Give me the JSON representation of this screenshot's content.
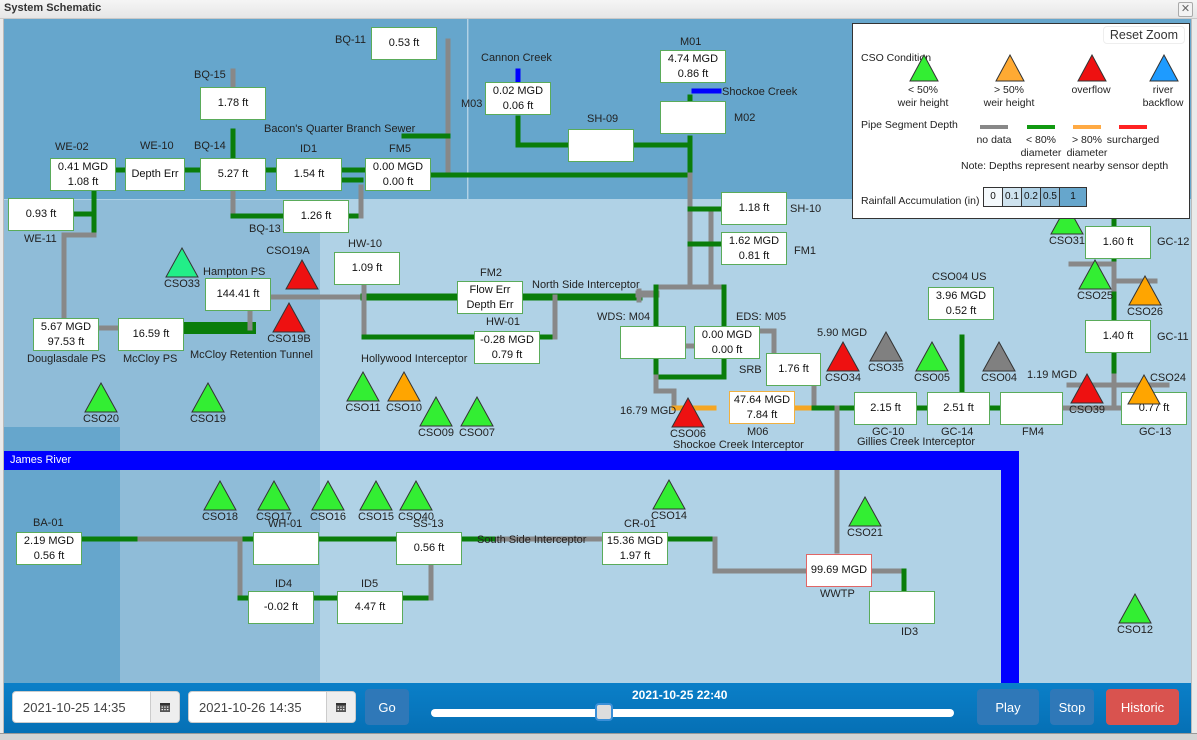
{
  "window": {
    "title": "System Schematic",
    "close_icon": "close-icon"
  },
  "legend": {
    "reset_zoom": "Reset Zoom",
    "cso_condition_title": "CSO Condition",
    "cso_conditions": [
      {
        "label1": "< 50%",
        "label2": "weir height",
        "color": "#33ee33"
      },
      {
        "label1": "> 50%",
        "label2": "weir height",
        "color": "#ffaa33"
      },
      {
        "label1": "overflow",
        "label2": "",
        "color": "#ee1111"
      },
      {
        "label1": "river",
        "label2": "backflow",
        "color": "#1e9bff"
      }
    ],
    "pipe_depth_title": "Pipe Segment Depth",
    "pipe_depths": [
      {
        "label1": "no data",
        "label2": "",
        "color": "#888888"
      },
      {
        "label1": "< 80%",
        "label2": "diameter",
        "color": "#119911"
      },
      {
        "label1": "> 80%",
        "label2": "diameter",
        "color": "#ffaa44"
      },
      {
        "label1": "surcharged",
        "label2": "",
        "color": "#ff2222"
      }
    ],
    "note": "Note: Depths represent nearby sensor depth",
    "rainfall_title": "Rainfall Accumulation (in)",
    "rainfall_scale": [
      {
        "label": "0",
        "color": "#f4f9fc"
      },
      {
        "label": "0.1",
        "color": "#cfe3ef"
      },
      {
        "label": "0.2",
        "color": "#b0d2e6"
      },
      {
        "label": "0.5",
        "color": "#8fbcd8"
      },
      {
        "label": "1",
        "color": "#66a6cc"
      }
    ]
  },
  "colors": {
    "pipe_ok": "#0a7d0a",
    "pipe_nodata": "#888888",
    "pipe_high": "#f5a623",
    "creek": "#0000ff",
    "river": "#0000ff"
  },
  "river": {
    "label": "James River"
  },
  "nodes": {
    "bq11": {
      "name": "BQ-11",
      "line1": "0.53 ft",
      "line2": ""
    },
    "bq15": {
      "name": "BQ-15",
      "line1": "1.78 ft",
      "line2": ""
    },
    "we02": {
      "name": "WE-02",
      "line1": "0.41 MGD",
      "line2": "1.08 ft"
    },
    "we10": {
      "name": "WE-10",
      "line1": "Depth Err",
      "line2": ""
    },
    "bq14": {
      "name": "BQ-14",
      "line1": "5.27 ft",
      "line2": ""
    },
    "id1": {
      "name": "ID1",
      "line1": "1.54 ft",
      "line2": ""
    },
    "fm5": {
      "name": "FM5",
      "line1": "0.00 MGD",
      "line2": "0.00 ft"
    },
    "bq13": {
      "name": "BQ-13",
      "line1": "1.26 ft",
      "line2": ""
    },
    "we11": {
      "name": "WE-11",
      "line1": "0.93 ft",
      "line2": ""
    },
    "m03": {
      "name": "M03",
      "line1": "0.02 MGD",
      "line2": "0.06 ft"
    },
    "sh09": {
      "name": "SH-09",
      "line1": "",
      "line2": ""
    },
    "m01": {
      "name": "M01",
      "line1": "4.74 MGD",
      "line2": "0.86 ft"
    },
    "m02": {
      "name": "M02",
      "line1": "",
      "line2": ""
    },
    "sh10": {
      "name": "SH-10",
      "line1": "1.18 ft",
      "line2": ""
    },
    "fm1": {
      "name": "FM1",
      "line1": "1.62 MGD",
      "line2": "0.81 ft"
    },
    "hw10": {
      "name": "HW-10",
      "line1": "1.09 ft",
      "line2": ""
    },
    "hampton": {
      "name": "Hampton PS",
      "line1": "144.41 ft",
      "line2": ""
    },
    "douglasdale": {
      "name": "Douglasdale PS",
      "line1": "5.67 MGD",
      "line2": "97.53 ft"
    },
    "mccloy": {
      "name": "McCloy PS",
      "line1": "16.59 ft",
      "line2": ""
    },
    "fm2": {
      "name": "FM2",
      "line1": "Flow Err",
      "line2": "Depth Err"
    },
    "hw01": {
      "name": "HW-01",
      "line1": "-0.28 MGD",
      "line2": "0.79 ft"
    },
    "m04": {
      "name": "WDS: M04",
      "line1": "",
      "line2": ""
    },
    "m05": {
      "name": "EDS: M05",
      "line1": "0.00 MGD",
      "line2": "0.00 ft"
    },
    "srb": {
      "name": "SRB",
      "line1": "1.76 ft",
      "line2": ""
    },
    "m06": {
      "name": "M06",
      "line1": "47.64 MGD",
      "line2": "7.84 ft"
    },
    "cso04us": {
      "name": "CSO04 US",
      "line1": "3.96 MGD",
      "line2": "0.52 ft"
    },
    "gc10": {
      "name": "GC-10",
      "line1": "2.15 ft",
      "line2": ""
    },
    "gc14": {
      "name": "GC-14",
      "line1": "2.51 ft",
      "line2": ""
    },
    "fm4": {
      "name": "FM4",
      "line1": "",
      "line2": ""
    },
    "gc12": {
      "name": "GC-12",
      "line1": "1.60 ft",
      "line2": ""
    },
    "gc11": {
      "name": "GC-11",
      "line1": "1.40 ft",
      "line2": ""
    },
    "gc13": {
      "name": "GC-13",
      "line1": "0.77 ft",
      "line2": ""
    },
    "ba01": {
      "name": "BA-01",
      "line1": "2.19 MGD",
      "line2": "0.56 ft"
    },
    "wh01": {
      "name": "WH-01",
      "line1": "",
      "line2": ""
    },
    "ss13": {
      "name": "SS-13",
      "line1": "0.56 ft",
      "line2": ""
    },
    "id4": {
      "name": "ID4",
      "line1": "-0.02 ft",
      "line2": ""
    },
    "id5": {
      "name": "ID5",
      "line1": "4.47 ft",
      "line2": ""
    },
    "cr01": {
      "name": "CR-01",
      "line1": "15.36 MGD",
      "line2": "1.97 ft"
    },
    "wwtp": {
      "name": "WWTP",
      "line1": "99.69 MGD",
      "line2": ""
    },
    "id3": {
      "name": "ID3",
      "line1": "",
      "line2": ""
    }
  },
  "labels": {
    "bacons_quarter": "Bacon's Quarter Branch Sewer",
    "cannon_creek": "Cannon Creek",
    "shockoe_creek": "Shockoe Creek",
    "north_side": "North Side Interceptor",
    "hollywood": "Hollywood Interceptor",
    "mccloy_tunnel": "McCloy Retention Tunnel",
    "shockoe_interceptor": "Shockoe Creek Interceptor",
    "gillies": "Gillies Creek Interceptor",
    "south_side": "South Side Interceptor"
  },
  "csos": [
    {
      "id": "CSO33",
      "status": "lt50",
      "color": "#22ee88",
      "flow": ""
    },
    {
      "id": "CSO19A",
      "status": "overflow",
      "color": "#ee1111",
      "flow": ""
    },
    {
      "id": "CSO19B",
      "status": "overflow",
      "color": "#ee1111",
      "flow": ""
    },
    {
      "id": "CSO20",
      "status": "lt50",
      "color": "#33ee33",
      "flow": ""
    },
    {
      "id": "CSO19",
      "status": "lt50",
      "color": "#33ee33",
      "flow": ""
    },
    {
      "id": "CSO11",
      "status": "lt50",
      "color": "#33ee33",
      "flow": ""
    },
    {
      "id": "CSO10",
      "status": "gt50",
      "color": "#ffa500",
      "flow": ""
    },
    {
      "id": "CSO09",
      "status": "lt50",
      "color": "#33ee33",
      "flow": ""
    },
    {
      "id": "CSO07",
      "status": "lt50",
      "color": "#33ee33",
      "flow": ""
    },
    {
      "id": "CSO06",
      "status": "overflow",
      "color": "#ee1111",
      "flow": "16.79 MGD"
    },
    {
      "id": "CSO34",
      "status": "overflow",
      "color": "#ee1111",
      "flow": "5.90 MGD"
    },
    {
      "id": "CSO35",
      "status": "nodata",
      "color": "#808080",
      "flow": ""
    },
    {
      "id": "CSO05",
      "status": "lt50",
      "color": "#33ee33",
      "flow": ""
    },
    {
      "id": "CSO04",
      "status": "nodata",
      "color": "#808080",
      "flow": ""
    },
    {
      "id": "CSO39",
      "status": "overflow",
      "color": "#ee1111",
      "flow": "1.19 MGD"
    },
    {
      "id": "CSO24",
      "status": "gt50",
      "color": "#ffa500",
      "flow": ""
    },
    {
      "id": "CSO31",
      "status": "lt50",
      "color": "#33ee33",
      "flow": ""
    },
    {
      "id": "CSO25",
      "status": "lt50",
      "color": "#33ee33",
      "flow": ""
    },
    {
      "id": "CSO26",
      "status": "gt50",
      "color": "#ffa500",
      "flow": ""
    },
    {
      "id": "CSO18",
      "status": "lt50",
      "color": "#33ee33",
      "flow": ""
    },
    {
      "id": "CSO17",
      "status": "lt50",
      "color": "#33ee33",
      "flow": ""
    },
    {
      "id": "CSO16",
      "status": "lt50",
      "color": "#33ee33",
      "flow": ""
    },
    {
      "id": "CSO15",
      "status": "lt50",
      "color": "#33ee33",
      "flow": ""
    },
    {
      "id": "CSO40",
      "status": "lt50",
      "color": "#33ee33",
      "flow": ""
    },
    {
      "id": "CSO14",
      "status": "lt50",
      "color": "#33ee33",
      "flow": ""
    },
    {
      "id": "CSO21",
      "status": "lt50",
      "color": "#33ee33",
      "flow": ""
    },
    {
      "id": "CSO12",
      "status": "lt50",
      "color": "#33ee33",
      "flow": ""
    }
  ],
  "controls": {
    "start_date": "2021-10-25 14:35",
    "end_date": "2021-10-26 14:35",
    "go_label": "Go",
    "current_time": "2021-10-25 22:40",
    "slider_position": 0.33,
    "play_label": "Play",
    "stop_label": "Stop",
    "historic_label": "Historic",
    "calendar_icon": "calendar-icon"
  }
}
